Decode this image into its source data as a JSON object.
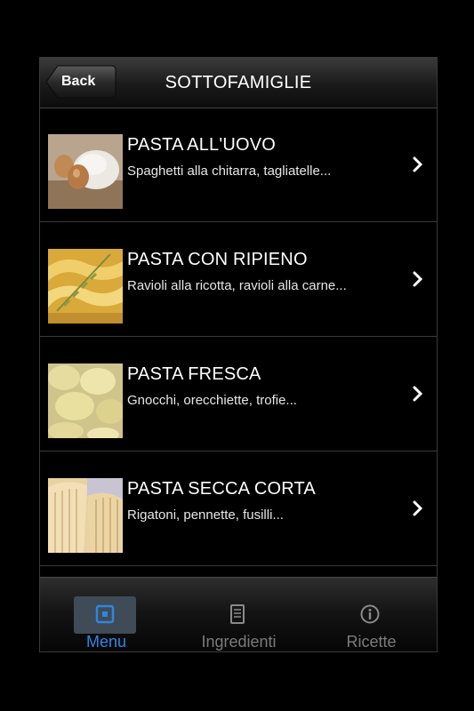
{
  "navbar": {
    "back_label": "Back",
    "title": "SOTTOFAMIGLIE"
  },
  "items": [
    {
      "title": "PASTA ALL'UOVO",
      "subtitle": "Spaghetti alla chitarra, tagliatelle..."
    },
    {
      "title": "PASTA CON RIPIENO",
      "subtitle": "Ravioli alla ricotta, ravioli alla carne..."
    },
    {
      "title": "PASTA FRESCA",
      "subtitle": "Gnocchi, orecchiette, trofie..."
    },
    {
      "title": "PASTA SECCA CORTA",
      "subtitle": "Rigatoni, pennette, fusilli..."
    }
  ],
  "tabs": [
    {
      "label": "Menu",
      "icon": "menu-icon",
      "active": true
    },
    {
      "label": "Ingredienti",
      "icon": "list-icon",
      "active": false
    },
    {
      "label": "Ricette",
      "icon": "info-icon",
      "active": false
    }
  ],
  "colors": {
    "active_tab": "#2f86e0",
    "inactive_tab": "#7b7b7b",
    "background": "#000000"
  }
}
